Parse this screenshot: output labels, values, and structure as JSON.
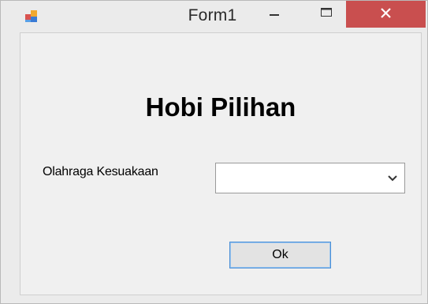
{
  "window": {
    "title": "Form1"
  },
  "titlebar": {
    "icons": {
      "app": "app-icon",
      "minimize": "minimize-icon",
      "maximize": "maximize-icon",
      "close": "close-icon"
    },
    "close_color": "#c94f4f"
  },
  "form": {
    "heading": "Hobi Pilihan",
    "sport_label": "Olahraga Kesuakaan",
    "sport_value": "",
    "dropdown_icon": "chevron-down-icon",
    "ok_label": "Ok"
  },
  "colors": {
    "focus_border": "#4a8fd6"
  }
}
